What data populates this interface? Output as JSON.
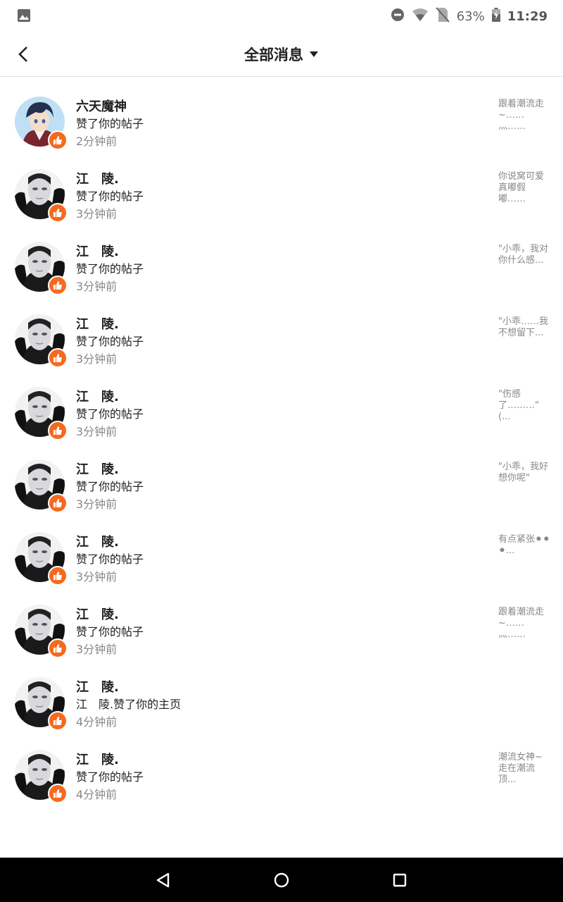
{
  "status_bar": {
    "battery_percent": "63%",
    "time": "11:29",
    "icons": [
      "image-icon",
      "do-not-disturb-icon",
      "wifi-icon",
      "no-sim-icon",
      "battery-charging-icon"
    ]
  },
  "header": {
    "title": "全部消息",
    "back_icon": "chevron-left-icon",
    "dropdown_icon": "triangle-down-icon"
  },
  "colors": {
    "like_badge": "#f56a1e",
    "secondary_text": "#888888",
    "nav_bar": "#000000"
  },
  "notifications": [
    {
      "name": "",
      "action": "赞了你的帖子",
      "time": "2分钟前",
      "preview": "走在潮流顶...",
      "avatar": "purple"
    },
    {
      "name": "六天魔神",
      "action": "赞了你的帖子",
      "time": "2分钟前",
      "preview": "跟着潮流走~……灬……",
      "avatar": "anime"
    },
    {
      "name": "江　陵.",
      "action": "赞了你的帖子",
      "time": "3分钟前",
      "preview": "你说窝可爱真嘟假嘟……",
      "avatar": "mask"
    },
    {
      "name": "江　陵.",
      "action": "赞了你的帖子",
      "time": "3分钟前",
      "preview": "\"小乖，我对你什么感...",
      "avatar": "mask"
    },
    {
      "name": "江　陵.",
      "action": "赞了你的帖子",
      "time": "3分钟前",
      "preview": "\"小乖……我不想留下...",
      "avatar": "mask"
    },
    {
      "name": "江　陵.",
      "action": "赞了你的帖子",
      "time": "3分钟前",
      "preview": "\"伤感了………\"(...",
      "avatar": "mask"
    },
    {
      "name": "江　陵.",
      "action": "赞了你的帖子",
      "time": "3分钟前",
      "preview": "\"小乖，我好想你呢\"",
      "avatar": "mask"
    },
    {
      "name": "江　陵.",
      "action": "赞了你的帖子",
      "time": "3分钟前",
      "preview": "有点紧张⚫⚫⚫...",
      "avatar": "mask"
    },
    {
      "name": "江　陵.",
      "action": "赞了你的帖子",
      "time": "3分钟前",
      "preview": "跟着潮流走~……灬……",
      "avatar": "mask"
    },
    {
      "name": "江　陵.",
      "action": "江　陵.赞了你的主页",
      "time": "4分钟前",
      "preview": "",
      "avatar": "mask"
    },
    {
      "name": "江　陵.",
      "action": "赞了你的帖子",
      "time": "4分钟前",
      "preview": "潮流女神~走在潮流顶...",
      "avatar": "mask"
    }
  ],
  "nav_bar": {
    "back": "triangle-back-icon",
    "home": "circle-home-icon",
    "recents": "square-recents-icon"
  }
}
